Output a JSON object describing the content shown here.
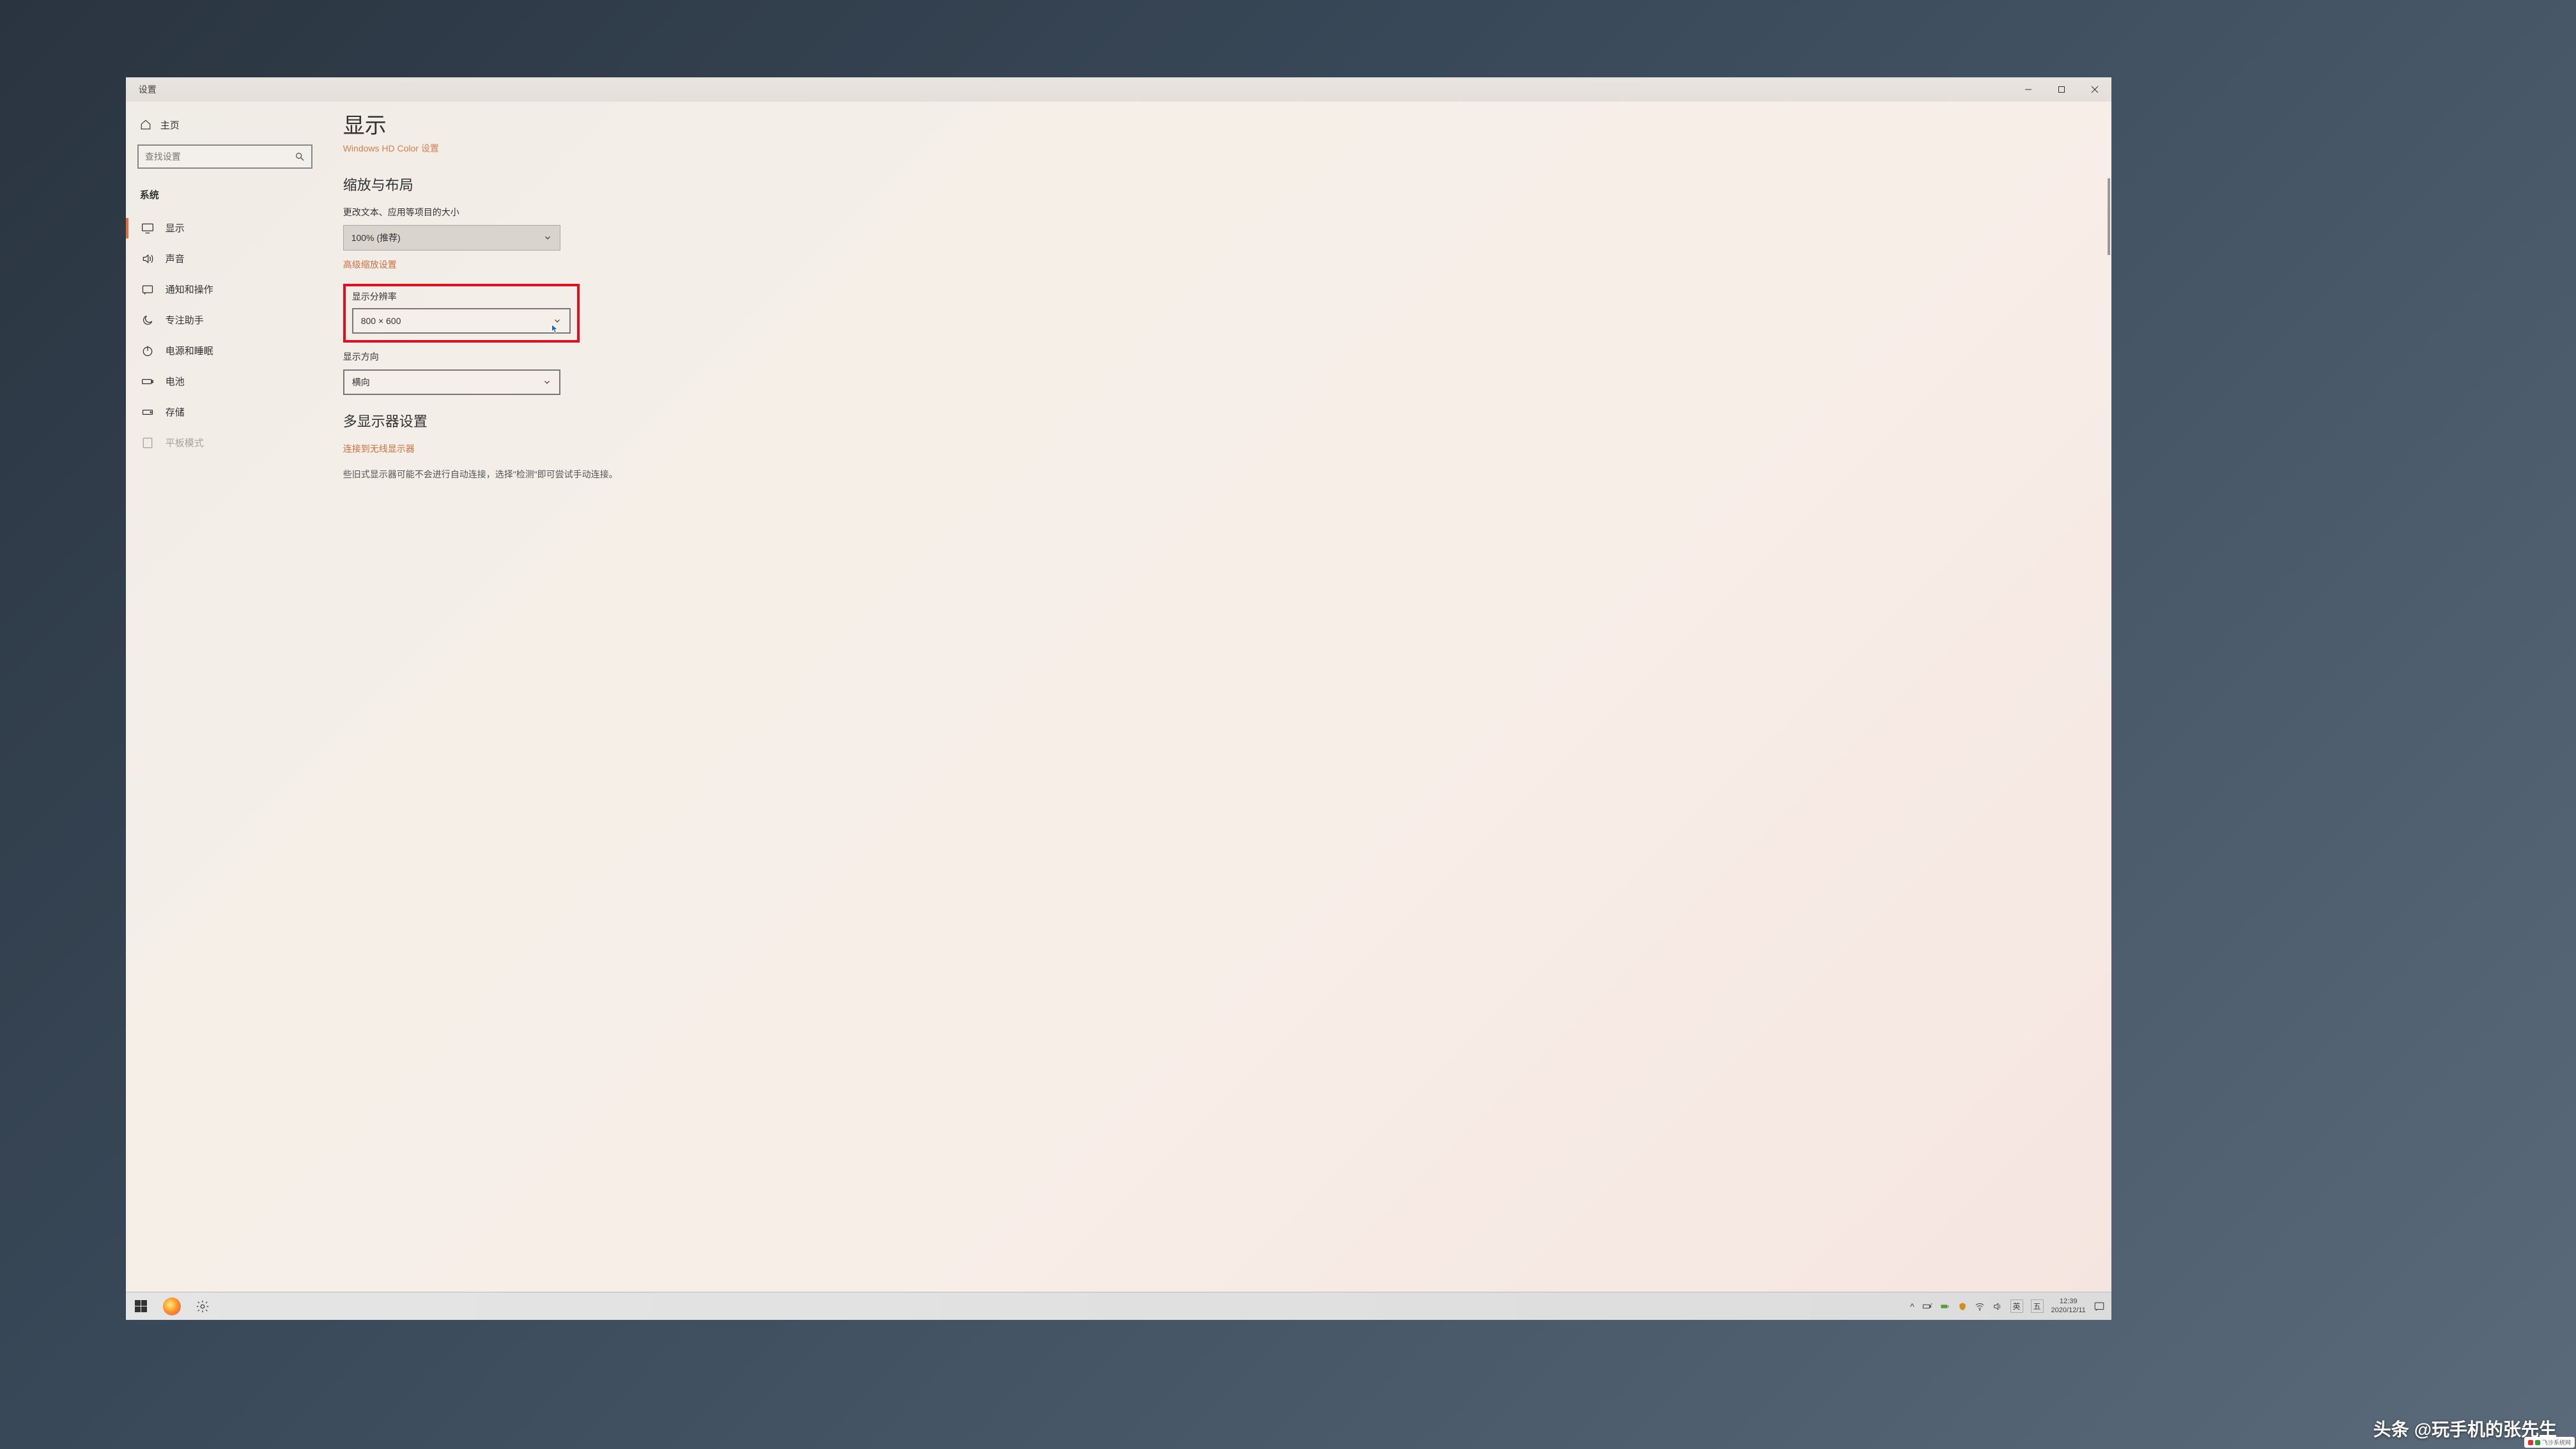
{
  "window": {
    "title": "设置"
  },
  "sidebar": {
    "home_label": "主页",
    "search_placeholder": "查找设置",
    "category": "系统",
    "items": [
      {
        "label": "显示",
        "icon": "monitor-icon",
        "active": true
      },
      {
        "label": "声音",
        "icon": "sound-icon",
        "active": false
      },
      {
        "label": "通知和操作",
        "icon": "notification-icon",
        "active": false
      },
      {
        "label": "专注助手",
        "icon": "moon-icon",
        "active": false
      },
      {
        "label": "电源和睡眠",
        "icon": "power-icon",
        "active": false
      },
      {
        "label": "电池",
        "icon": "battery-icon",
        "active": false
      },
      {
        "label": "存储",
        "icon": "storage-icon",
        "active": false
      },
      {
        "label": "平板模式",
        "icon": "tablet-icon",
        "active": false
      }
    ]
  },
  "content": {
    "page_heading": "显示",
    "hd_color_link": "Windows HD Color 设置",
    "section_scale": "缩放与布局",
    "scale_label": "更改文本、应用等项目的大小",
    "scale_value": "100% (推荐)",
    "advanced_scale_link": "高级缩放设置",
    "resolution_label": "显示分辨率",
    "resolution_value": "800 × 600",
    "orientation_label": "显示方向",
    "orientation_value": "横向",
    "section_multi": "多显示器设置",
    "wireless_link": "连接到无线显示器",
    "truncated": "些旧式显示器可能不会进行自动连接，选择\"检测\"即可尝试手动连接。"
  },
  "taskbar": {
    "ime1": "英",
    "ime2": "五",
    "time": "12:39",
    "date": "2020/12/11"
  },
  "watermark": {
    "prefix": "头条",
    "text": "@玩手机的张先生",
    "badge": "飞沙系统网"
  }
}
